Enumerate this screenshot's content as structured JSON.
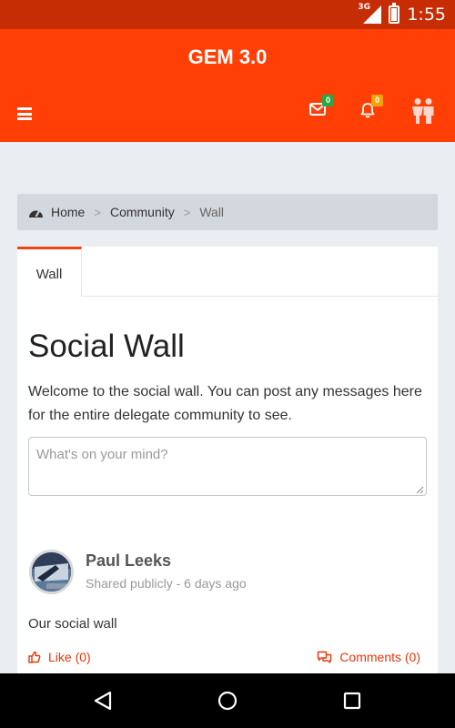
{
  "status": {
    "network": "3G",
    "time": "1:55"
  },
  "app": {
    "title": "GEM 3.0"
  },
  "header": {
    "mail_badge": "0",
    "bell_badge": "0"
  },
  "breadcrumb": {
    "home": "Home",
    "separator": ">",
    "community": "Community",
    "current": "Wall"
  },
  "tabs": [
    {
      "label": "Wall"
    }
  ],
  "page": {
    "title": "Social Wall",
    "intro": "Welcome to the social wall. You can post any messages here for the entire delegate community to see.",
    "post_placeholder": "What's on your mind?"
  },
  "post": {
    "author": "Paul Leeks",
    "meta": "Shared publicly - 6 days ago",
    "text": "Our social wall",
    "like_label": "Like (0)",
    "comments_label": "Comments (0)"
  },
  "colors": {
    "appbar": "#ff3f06",
    "statusbar": "#c62d05",
    "accent": "#e8350a",
    "mail_badge": "#27a844",
    "bell_badge": "#f0a30a"
  }
}
